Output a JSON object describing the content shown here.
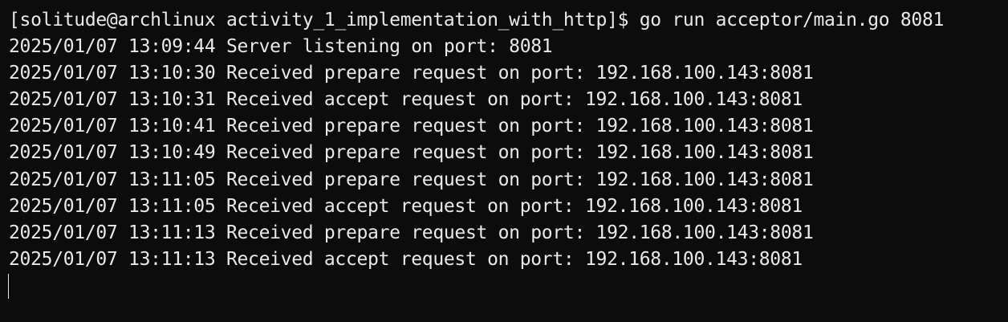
{
  "terminal": {
    "prompt": "[solitude@archlinux activity_1_implementation_with_http]$ go run acceptor/main.go 8081",
    "log": [
      "2025/01/07 13:09:44 Server listening on port: 8081",
      "2025/01/07 13:10:30 Received prepare request on port: 192.168.100.143:8081",
      "2025/01/07 13:10:31 Received accept request on port: 192.168.100.143:8081",
      "2025/01/07 13:10:41 Received prepare request on port: 192.168.100.143:8081",
      "2025/01/07 13:10:49 Received prepare request on port: 192.168.100.143:8081",
      "2025/01/07 13:11:05 Received prepare request on port: 192.168.100.143:8081",
      "2025/01/07 13:11:05 Received accept request on port: 192.168.100.143:8081",
      "2025/01/07 13:11:13 Received prepare request on port: 192.168.100.143:8081",
      "2025/01/07 13:11:13 Received accept request on port: 192.168.100.143:8081"
    ]
  }
}
